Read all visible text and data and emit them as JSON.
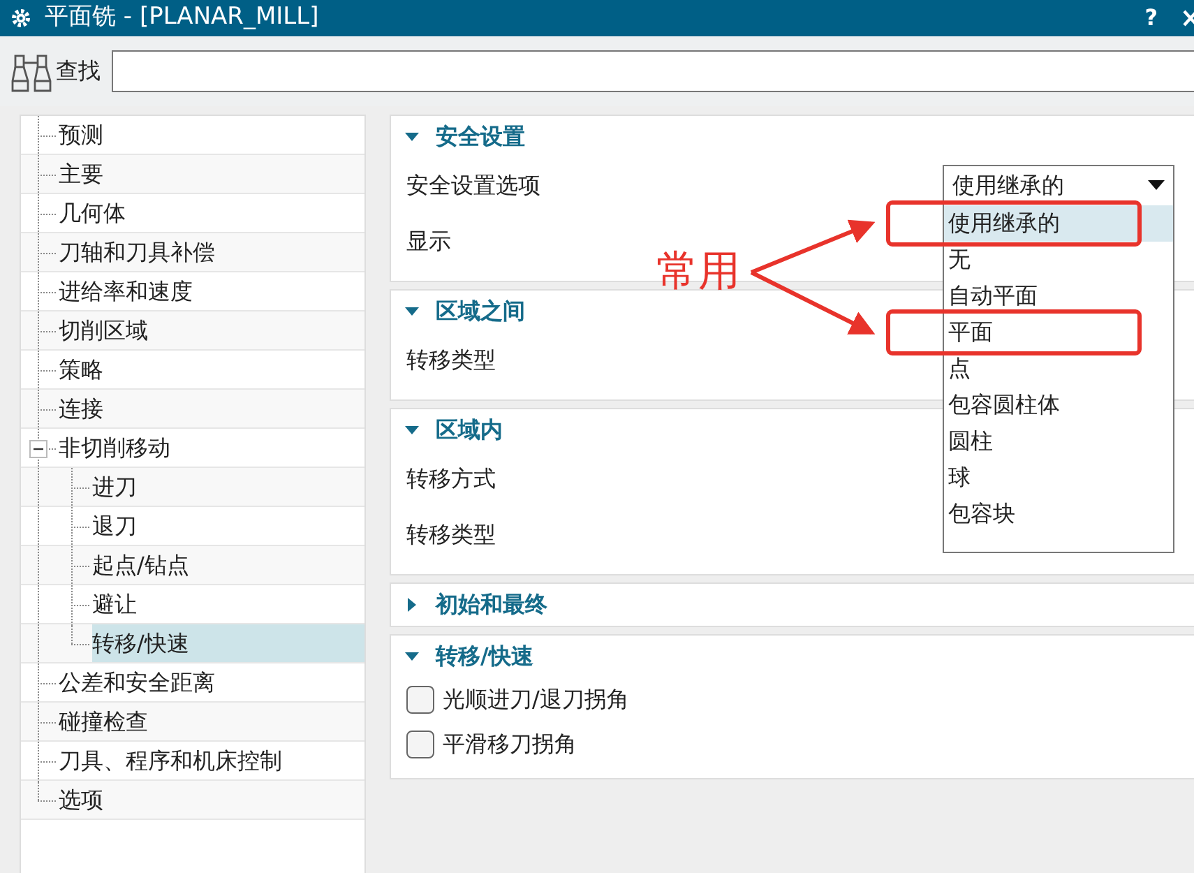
{
  "window": {
    "title": "平面铣 - [PLANAR_MILL]",
    "help": "?"
  },
  "search": {
    "label": "查找"
  },
  "tree": [
    {
      "label": "预测",
      "selected": false
    },
    {
      "label": "主要",
      "selected": false
    },
    {
      "label": "几何体",
      "selected": false
    },
    {
      "label": "刀轴和刀具补偿",
      "selected": false
    },
    {
      "label": "进给率和速度",
      "selected": false
    },
    {
      "label": "切削区域",
      "selected": false
    },
    {
      "label": "策略",
      "selected": false
    },
    {
      "label": "连接",
      "selected": false
    },
    {
      "label": "非切削移动",
      "selected": false,
      "expanded": true,
      "children": [
        {
          "label": "进刀",
          "selected": false
        },
        {
          "label": "退刀",
          "selected": false
        },
        {
          "label": "起点/钻点",
          "selected": false
        },
        {
          "label": "避让",
          "selected": false
        },
        {
          "label": "转移/快速",
          "selected": true
        }
      ]
    },
    {
      "label": "公差和安全距离",
      "selected": false
    },
    {
      "label": "碰撞检查",
      "selected": false
    },
    {
      "label": "刀具、程序和机床控制",
      "selected": false
    },
    {
      "label": "选项",
      "selected": false
    }
  ],
  "sections": [
    {
      "title": "安全设置",
      "expanded": true,
      "rows": [
        {
          "kind": "select",
          "label": "安全设置选项",
          "value": "使用继承的",
          "open": true,
          "options": [
            {
              "label": "使用继承的",
              "selected": true,
              "marked": true
            },
            {
              "label": "无",
              "selected": false,
              "marked": false
            },
            {
              "label": "自动平面",
              "selected": false,
              "marked": false
            },
            {
              "label": "平面",
              "selected": false,
              "marked": true
            },
            {
              "label": "点",
              "selected": false,
              "marked": false
            },
            {
              "label": "包容圆柱体",
              "selected": false,
              "marked": false
            },
            {
              "label": "圆柱",
              "selected": false,
              "marked": false
            },
            {
              "label": "球",
              "selected": false,
              "marked": false
            },
            {
              "label": "包容块",
              "selected": false,
              "marked": false
            }
          ]
        },
        {
          "kind": "label",
          "label": "显示"
        }
      ]
    },
    {
      "title": "区域之间",
      "expanded": true,
      "rows": [
        {
          "kind": "label",
          "label": "转移类型"
        }
      ]
    },
    {
      "title": "区域内",
      "expanded": true,
      "rows": [
        {
          "kind": "label",
          "label": "转移方式"
        },
        {
          "kind": "label",
          "label": "转移类型"
        }
      ]
    },
    {
      "title": "初始和最终",
      "expanded": false
    },
    {
      "title": "转移/快速",
      "expanded": true,
      "rows": [
        {
          "kind": "checkbox",
          "label": "光顺进刀/退刀拐角",
          "checked": false
        },
        {
          "kind": "checkbox",
          "label": "平滑移刀拐角",
          "checked": false
        }
      ]
    }
  ],
  "annotation": {
    "text": "常用"
  }
}
